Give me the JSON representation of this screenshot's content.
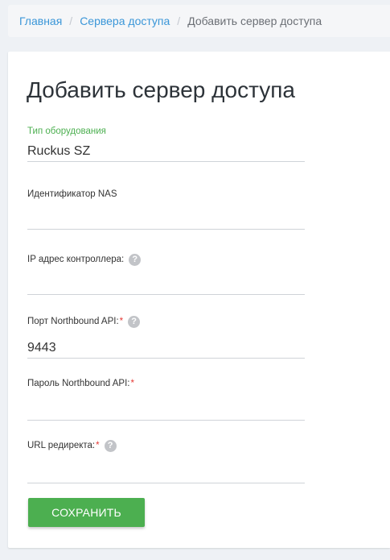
{
  "breadcrumb": {
    "home": "Главная",
    "servers": "Сервера доступа",
    "current": "Добавить сервер доступа",
    "separator": "/"
  },
  "form": {
    "title": "Добавить сервер доступа",
    "equipment_type": {
      "label": "Тип оборудования",
      "value": "Ruckus SZ"
    },
    "nas_id": {
      "label": "Идентификатор NAS",
      "value": ""
    },
    "controller_ip": {
      "label": "IP адрес контроллера:",
      "value": "",
      "help_icon": "question-icon"
    },
    "nb_port": {
      "label": "Порт Northbound API:",
      "required_mark": "*",
      "value": "9443",
      "help_icon": "question-icon"
    },
    "nb_password": {
      "label": "Пароль Northbound API:",
      "required_mark": "*",
      "value": ""
    },
    "redirect_url": {
      "label": "URL редиректа:",
      "required_mark": "*",
      "value": "",
      "help_icon": "question-icon"
    },
    "save_label": "СОХРАНИТЬ"
  },
  "colors": {
    "accent_green": "#4caf50",
    "link_blue": "#3a96d8",
    "required_red": "#e53935",
    "page_bg": "#eef1f5"
  }
}
